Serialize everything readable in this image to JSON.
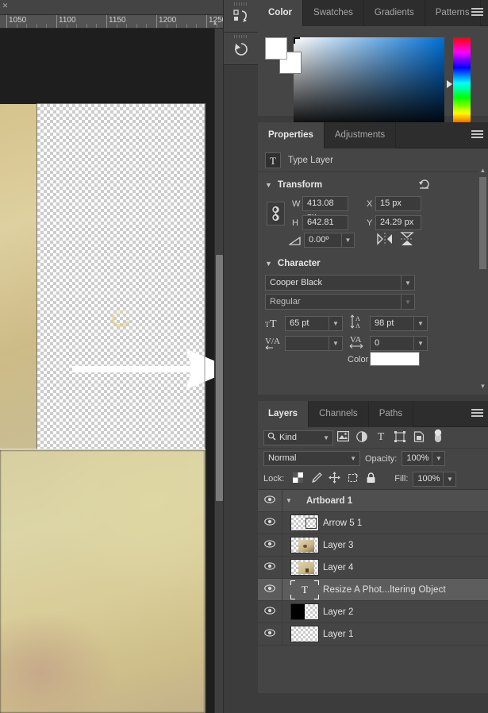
{
  "document": {
    "tab_close": "✕",
    "ruler": {
      "unit": "px",
      "labels": [
        "1050",
        "1100",
        "1150",
        "1200",
        "1250"
      ],
      "collapse_icon": "chevron-up"
    },
    "canvas": {
      "artboard_name": "Artboard 1",
      "arrow_shape_name": "Arrow 5 1"
    }
  },
  "dock": {
    "buttons": [
      {
        "name": "libraries-panel",
        "glyph": "⬚"
      },
      {
        "name": "history-panel",
        "glyph": "↺"
      }
    ]
  },
  "color_panel": {
    "tabs": [
      {
        "label": "Color",
        "active": true
      },
      {
        "label": "Swatches",
        "active": false
      },
      {
        "label": "Gradients",
        "active": false
      },
      {
        "label": "Patterns",
        "active": false
      }
    ],
    "menu_icon": "hamburger-icon",
    "foreground_color": "#ffffff",
    "background_color": "#ffffff",
    "field_base_hue": "#0070d6"
  },
  "properties_panel": {
    "tabs": [
      {
        "label": "Properties",
        "active": true
      },
      {
        "label": "Adjustments",
        "active": false
      }
    ],
    "menu_icon": "hamburger-icon",
    "layer_type_icon": "T",
    "layer_type_label": "Type Layer",
    "transform": {
      "title": "Transform",
      "reset_icon": "reset-icon",
      "link_icon": "link-icon",
      "w_label": "W",
      "w_value": "413.08 px",
      "h_label": "H",
      "h_value": "642.81 px",
      "x_label": "X",
      "x_value": "15 px",
      "y_label": "Y",
      "y_value": "24.29 px",
      "angle_value": "0.00º",
      "flip_h_icon": "flip-horizontal-icon",
      "flip_v_icon": "flip-vertical-icon"
    },
    "character": {
      "title": "Character",
      "font_family": "Cooper Black",
      "font_style": "Regular",
      "font_size": "65 pt",
      "leading": "98 pt",
      "kerning": "",
      "tracking": "0",
      "color_label": "Color",
      "color_value": "#ffffff"
    }
  },
  "layers_panel": {
    "tabs": [
      {
        "label": "Layers",
        "active": true
      },
      {
        "label": "Channels",
        "active": false
      },
      {
        "label": "Paths",
        "active": false
      }
    ],
    "menu_icon": "hamburger-icon",
    "filter": {
      "kind_label": "Kind",
      "search_icon": "search-icon",
      "icons": [
        "pixel-filter-icon",
        "adjustment-filter-icon",
        "type-filter-icon",
        "shape-filter-icon",
        "smart-object-filter-icon"
      ],
      "toggle_name": "filter-enable-toggle"
    },
    "blend_mode": "Normal",
    "opacity_label": "Opacity:",
    "opacity_value": "100%",
    "lock_label": "Lock:",
    "lock_icons": [
      "lock-transparent-pixels-icon",
      "lock-image-pixels-icon",
      "lock-position-icon",
      "lock-nesting-icon",
      "lock-all-icon"
    ],
    "fill_label": "Fill:",
    "fill_value": "100%",
    "layers": [
      {
        "name": "Artboard 1",
        "type": "group",
        "visible": true,
        "selected": false
      },
      {
        "name": "Arrow 5 1",
        "type": "shape",
        "visible": true,
        "selected": false
      },
      {
        "name": "Layer 3",
        "type": "image",
        "visible": true,
        "selected": false
      },
      {
        "name": "Layer 4",
        "type": "image2",
        "visible": true,
        "selected": false
      },
      {
        "name": "Resize  A Phot...ltering    Object",
        "type": "text",
        "visible": true,
        "selected": true
      },
      {
        "name": "Layer 2",
        "type": "half",
        "visible": true,
        "selected": false
      },
      {
        "name": "Layer 1",
        "type": "empty",
        "visible": true,
        "selected": false
      }
    ],
    "eye_icon": "eye-icon"
  },
  "colors": {
    "panel_bg": "#454545",
    "panel_tab_bg": "#2d2d2d",
    "app_bg": "#3c3c3c",
    "canvas_bg": "#1e1e1e",
    "selected_row": "#5d5d5d"
  }
}
